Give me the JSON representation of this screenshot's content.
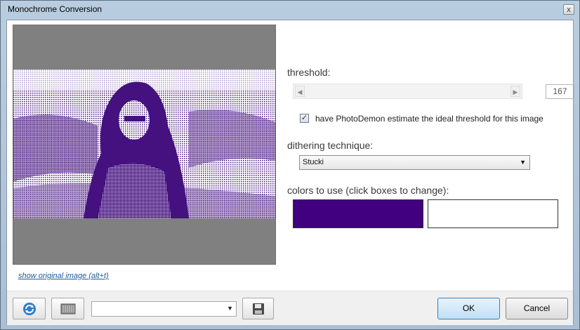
{
  "window": {
    "title": "Monochrome Conversion",
    "close_glyph": "x"
  },
  "preview": {
    "link_text": "show original image (alt+t)",
    "monochrome_dark": "#44117f",
    "monochrome_light": "#ffffff",
    "background": "#808080"
  },
  "threshold": {
    "label": "threshold:",
    "value": "167",
    "left_arrow": "◀",
    "right_arrow": "▶"
  },
  "auto_threshold": {
    "checked": true,
    "check_glyph": "✓",
    "label": "have PhotoDemon estimate the ideal threshold for this image"
  },
  "dithering": {
    "label": "dithering technique:",
    "selected": "Stucki",
    "arrow": "▼"
  },
  "colors": {
    "label": "colors to use (click boxes to change):",
    "color1": "#400080",
    "color2": "#ffffff"
  },
  "footer": {
    "preset_value": "",
    "combo_arrow": "▼",
    "ok_label": "OK",
    "cancel_label": "Cancel",
    "icons": [
      "refresh-icon",
      "randomize-icon",
      "save-preset-icon"
    ]
  }
}
